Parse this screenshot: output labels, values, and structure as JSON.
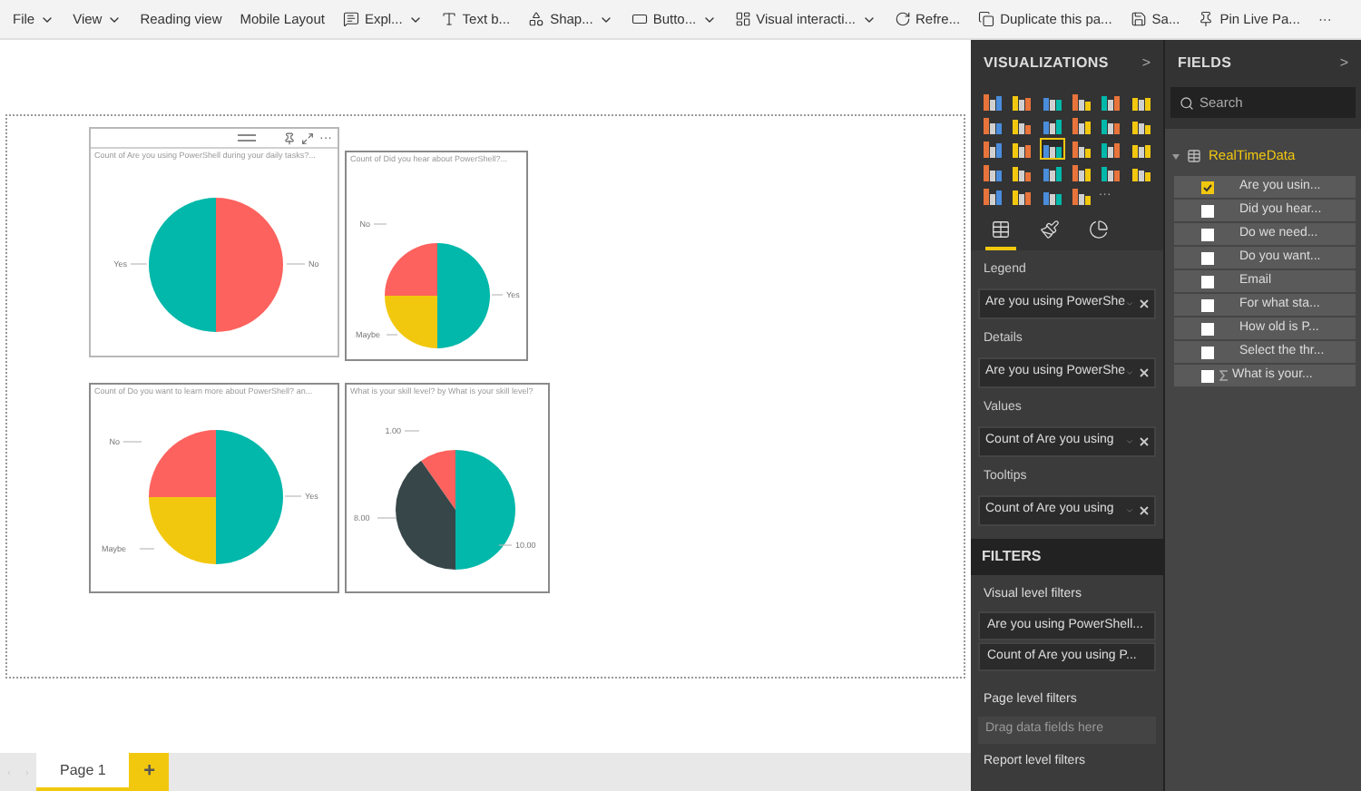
{
  "toolbar": [
    {
      "label": "File",
      "kind": "menu"
    },
    {
      "label": "View",
      "kind": "menu"
    },
    {
      "label": "Reading view",
      "kind": "plain"
    },
    {
      "label": "Mobile Layout",
      "kind": "plain"
    },
    {
      "label": "Expl...",
      "kind": "icon-menu"
    },
    {
      "label": "Text b...",
      "kind": "icon"
    },
    {
      "label": "Shap...",
      "kind": "icon-menu"
    },
    {
      "label": "Butto...",
      "kind": "icon-menu"
    },
    {
      "label": "Visual interacti...",
      "kind": "icon-menu"
    },
    {
      "label": "Refre...",
      "kind": "icon"
    },
    {
      "label": "Duplicate this pa...",
      "kind": "icon"
    },
    {
      "label": "Sa...",
      "kind": "icon"
    },
    {
      "label": "Pin Live Pa...",
      "kind": "icon"
    },
    {
      "label": "···",
      "kind": "more"
    }
  ],
  "visuals": [
    {
      "title": "Count of Are you using PowerShell during your daily tasks?...",
      "selected": true,
      "header_more": "···",
      "slices": [
        {
          "label": "Yes",
          "color": "#01b8aa"
        },
        {
          "label": "No",
          "color": "#fd625e"
        }
      ]
    },
    {
      "title": "Count of Did you hear about PowerShell?...",
      "selected": false,
      "slices": [
        {
          "label": "No",
          "color": "#fd625e"
        },
        {
          "label": "Yes",
          "color": "#01b8aa"
        },
        {
          "label": "Maybe",
          "color": "#f2c80f"
        }
      ]
    },
    {
      "title": "Count of Do you want to learn more about PowerShell? an...",
      "selected": false,
      "slices": [
        {
          "label": "No",
          "color": "#fd625e"
        },
        {
          "label": "Yes",
          "color": "#01b8aa"
        },
        {
          "label": "Maybe",
          "color": "#f2c80f"
        }
      ]
    },
    {
      "title": "What is your skill level? by What is your skill level?",
      "selected": false,
      "slices": [
        {
          "label": "1.00",
          "color": "#fd625e"
        },
        {
          "label": "8.00",
          "color": "#374649"
        },
        {
          "label": "10.00",
          "color": "#01b8aa"
        }
      ]
    }
  ],
  "pages": [
    {
      "label": "Page 1",
      "selected": true
    }
  ],
  "add_page": "+",
  "visualizations": {
    "title": "VISUALIZATIONS",
    "collapse": ">",
    "gallery": [
      {
        "selected": false
      },
      {
        "selected": false
      },
      {
        "selected": false
      },
      {
        "selected": false
      },
      {
        "selected": false
      },
      {
        "selected": false
      },
      {
        "selected": false
      },
      {
        "selected": false
      },
      {
        "selected": false
      },
      {
        "selected": false
      },
      {
        "selected": false
      },
      {
        "selected": false
      },
      {
        "selected": false
      },
      {
        "selected": false
      },
      {
        "selected": true
      },
      {
        "selected": false
      },
      {
        "selected": false
      },
      {
        "selected": false
      },
      {
        "selected": false
      },
      {
        "selected": false
      },
      {
        "selected": false
      },
      {
        "selected": false
      },
      {
        "selected": false
      },
      {
        "selected": false
      },
      {
        "selected": false
      },
      {
        "selected": false
      },
      {
        "selected": false
      },
      {
        "selected": false
      }
    ],
    "gallery_more": "···",
    "pane_tabs": [
      {
        "selected": true
      },
      {
        "selected": false
      },
      {
        "selected": false
      }
    ],
    "wells": [
      {
        "label": "Legend",
        "field": "Are you using PowerShe"
      },
      {
        "label": "Details",
        "field": "Are you using PowerShe"
      },
      {
        "label": "Values",
        "field": "Count of Are you using"
      },
      {
        "label": "Tooltips",
        "field": "Count of Are you using"
      }
    ],
    "filters_title": "FILTERS",
    "visual_filters_label": "Visual level filters",
    "visual_filters": [
      "Are you using PowerShell...",
      "Count of Are you using P..."
    ],
    "page_filters_label": "Page level filters",
    "page_filters_drop": "Drag data fields here",
    "report_filters_label": "Report level filters"
  },
  "fields": {
    "title": "FIELDS",
    "collapse": ">",
    "search": {
      "placeholder": "Search"
    },
    "table": "RealTimeData",
    "items": [
      {
        "label": "Are you usin...",
        "checked": true,
        "kind": "text"
      },
      {
        "label": "Did you hear...",
        "checked": false,
        "kind": "text"
      },
      {
        "label": "Do we need...",
        "checked": false,
        "kind": "text"
      },
      {
        "label": "Do you want...",
        "checked": false,
        "kind": "text"
      },
      {
        "label": "Email",
        "checked": false,
        "kind": "text"
      },
      {
        "label": "For what sta...",
        "checked": false,
        "kind": "text"
      },
      {
        "label": "How old is P...",
        "checked": false,
        "kind": "text"
      },
      {
        "label": "Select the thr...",
        "checked": false,
        "kind": "text"
      },
      {
        "label": "What is your...",
        "checked": false,
        "kind": "measure"
      }
    ]
  }
}
